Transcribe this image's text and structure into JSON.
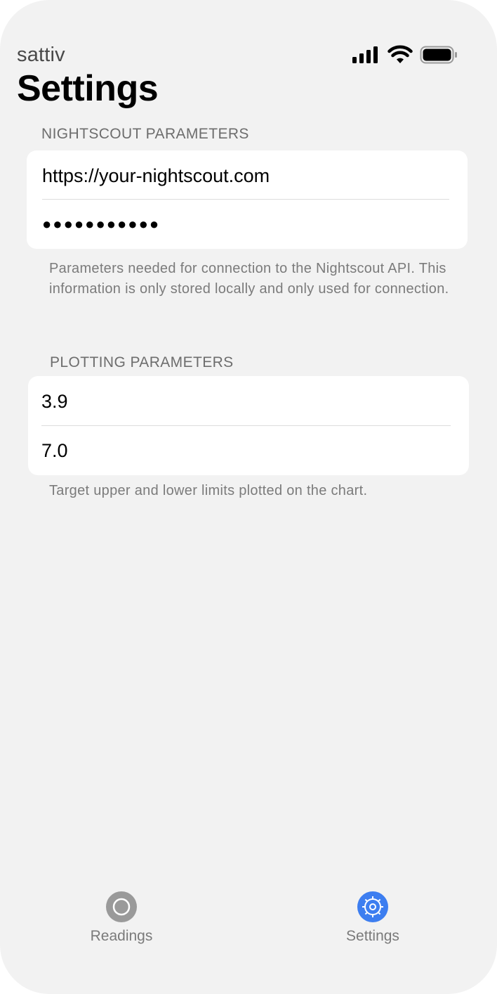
{
  "status_bar": {
    "carrier": "sattiv",
    "signal_icon": "cellular-signal-icon",
    "wifi_icon": "wifi-icon",
    "battery_icon": "battery-full-icon"
  },
  "page": {
    "title": "Settings"
  },
  "nightscout_section": {
    "header": "NIGHTSCOUT PARAMETERS",
    "url_value": "https://your-nightscout.com",
    "token_value": "●●●●●●●●●●●",
    "footer": "Parameters needed for connection to the Nightscout API. This information is only stored locally and only used for connection."
  },
  "plotting_section": {
    "header": "PLOTTING PARAMETERS",
    "lower_limit_value": "3.9",
    "upper_limit_value": "7.0",
    "footer": "Target upper and lower limits plotted on the chart."
  },
  "tab_bar": {
    "items": [
      {
        "label": "Readings",
        "icon": "circle-icon",
        "selected": false,
        "color": "#9a9a9a"
      },
      {
        "label": "Settings",
        "icon": "gear-icon",
        "selected": true,
        "color": "#3d7ef0"
      }
    ]
  },
  "colors": {
    "background": "#f2f2f2",
    "card": "#ffffff",
    "accent": "#3d7ef0",
    "secondary_text": "#7b7b7b"
  }
}
